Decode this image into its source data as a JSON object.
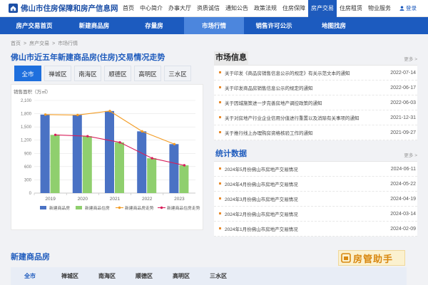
{
  "site": {
    "title": "佛山市住房保障和房产信息网"
  },
  "topnav": [
    "首页",
    "中心简介",
    "办事大厅",
    "资质诚信",
    "通知公告",
    "政策法规",
    "住房保障",
    "房产交易",
    "住房租赁",
    "物业服务"
  ],
  "login_label": "登录",
  "subnav": [
    "房产交易首页",
    "新建商品房",
    "存量房",
    "市场行情",
    "销售许可公示",
    "地图找房"
  ],
  "breadcrumb": [
    "首页",
    "房产交易",
    "市场行情"
  ],
  "chart_section": {
    "title": "佛山市近五年新建商品房(住房)交易情况走势"
  },
  "districts": [
    "全市",
    "禅城区",
    "南海区",
    "顺德区",
    "高明区",
    "三水区"
  ],
  "chart_data": {
    "type": "bar",
    "ylabel": "销售面积（万㎡）",
    "ylim": [
      0,
      2100
    ],
    "yticks": [
      0,
      300,
      600,
      900,
      1200,
      1500,
      1800,
      2100
    ],
    "categories": [
      "2019",
      "2020",
      "2021",
      "2022",
      "2023"
    ],
    "series": [
      {
        "name": "新建商品房",
        "kind": "bar",
        "color": "#4a72c4",
        "values": [
          1780,
          1770,
          1860,
          1400,
          1110
        ]
      },
      {
        "name": "新建商品住房",
        "kind": "bar",
        "color": "#8fcf6e",
        "values": [
          1320,
          1290,
          1150,
          790,
          630
        ]
      },
      {
        "name": "新建商品房走势",
        "kind": "line",
        "color": "#f39c24",
        "values": [
          1780,
          1770,
          1860,
          1400,
          1110
        ]
      },
      {
        "name": "新建商品住房走势",
        "kind": "line",
        "color": "#d81f5b",
        "values": [
          1320,
          1290,
          1150,
          790,
          630
        ]
      }
    ]
  },
  "market_info": {
    "title": "市场信息",
    "more": "更多 >",
    "items": [
      {
        "title": "关于印发《商品房销售信息公示的规定》有关示范文本的通知",
        "date": "2022-07-14"
      },
      {
        "title": "关于印发商品房销售信息公示的规定的通知",
        "date": "2022-06-17"
      },
      {
        "title": "关于因城施策进一步完善房地产调控政策的通知",
        "date": "2022-06-03"
      },
      {
        "title": "关于对房地产行业企业信用分值进行重置以及消除有关事项的通知",
        "date": "2021-12-31"
      },
      {
        "title": "关于推行线上办理购房资格核验工作的通知",
        "date": "2021-09-27"
      }
    ]
  },
  "statistics": {
    "title": "统计数据",
    "more": "更多 >",
    "items": [
      {
        "title": "2024年5月份佛山市房地产交易情况",
        "date": "2024-06-11"
      },
      {
        "title": "2024年4月份佛山市房地产交易情况",
        "date": "2024-05-22"
      },
      {
        "title": "2024年3月份佛山市房地产交易情况",
        "date": "2024-04-19"
      },
      {
        "title": "2024年2月份佛山市房地产交易情况",
        "date": "2024-03-14"
      },
      {
        "title": "2024年1月份佛山市房地产交易情况",
        "date": "2024-02-09"
      }
    ]
  },
  "new_house": {
    "title": "新建商品房",
    "tabs": [
      "全市",
      "禅城区",
      "南海区",
      "顺德区",
      "高明区",
      "三水区"
    ]
  },
  "assistant": {
    "label": "房管助手"
  }
}
